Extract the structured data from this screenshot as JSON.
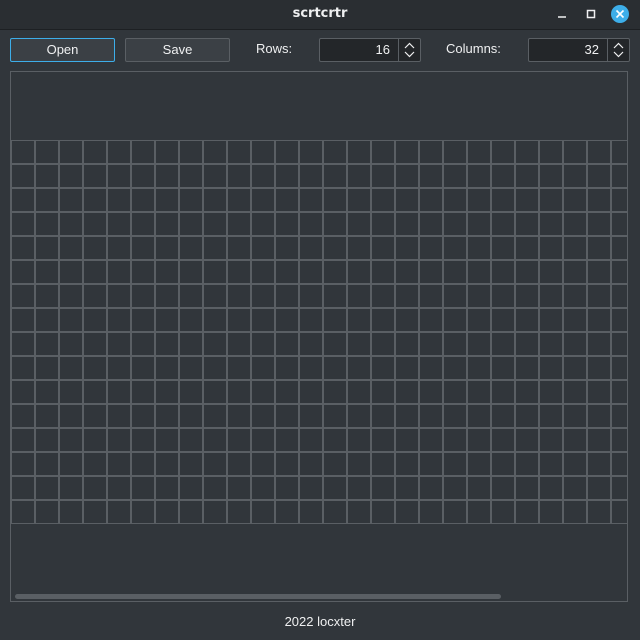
{
  "window": {
    "title": "scrtcrtr"
  },
  "toolbar": {
    "open_label": "Open",
    "save_label": "Save",
    "rows_label": "Rows:",
    "rows_value": "16",
    "columns_label": "Columns:",
    "columns_value": "32"
  },
  "grid": {
    "rows": 16,
    "columns": 32,
    "line_color": "#5a5f64",
    "cell_color": "#31363b"
  },
  "scrollbar": {
    "visible_fraction": 0.8
  },
  "footer": {
    "text": "2022 locxter"
  },
  "colors": {
    "accent": "#3daee9",
    "background": "#31363b",
    "titlebar": "#2a2e32"
  },
  "icons": [
    "minimize-icon",
    "maximize-icon",
    "close-icon",
    "spin-arrows-icon"
  ]
}
